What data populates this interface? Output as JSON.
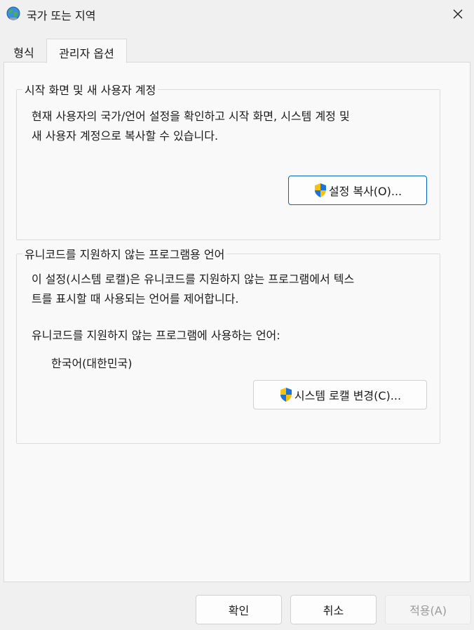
{
  "window": {
    "title": "국가 또는 지역",
    "icon": "globe-icon",
    "close_icon": "close-icon"
  },
  "tabs": [
    {
      "label": "형식",
      "selected": false
    },
    {
      "label": "관리자 옵션",
      "selected": true
    }
  ],
  "welcome_group": {
    "legend": "시작 화면 및 새 사용자 계정",
    "description_line1": "현재 사용자의 국가/언어 설정을 확인하고 시작 화면, 시스템 계정 및",
    "description_line2": "새 사용자 계정으로 복사할 수 있습니다.",
    "copy_button": "설정 복사(O)..."
  },
  "unicode_group": {
    "legend": "유니코드를 지원하지 않는 프로그램용 언어",
    "description_line1": "이 설정(시스템 로캘)은 유니코드를 지원하지 않는 프로그램에서 텍스",
    "description_line2": "트를 표시할 때 사용되는 언어를 제어합니다.",
    "current_label": "유니코드를 지원하지 않는 프로그램에 사용하는 언어:",
    "current_value": "한국어(대한민국)",
    "change_button": "시스템 로캘 변경(C)..."
  },
  "footer": {
    "ok": "확인",
    "cancel": "취소",
    "apply": "적용(A)"
  },
  "colors": {
    "accent": "#0067c0",
    "shield_blue": "#1e73d8",
    "shield_yellow": "#f5c211"
  }
}
